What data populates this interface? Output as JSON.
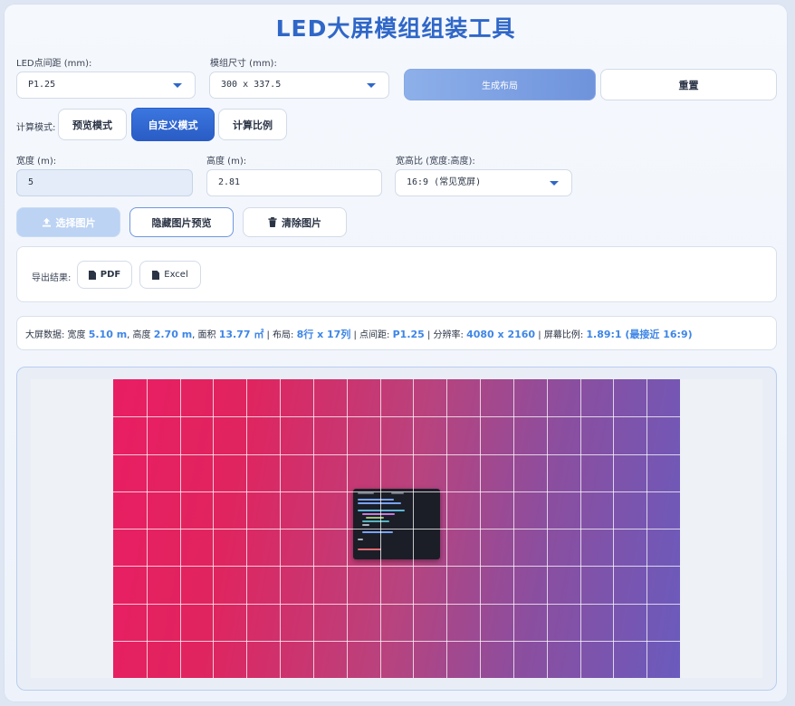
{
  "title": "LED大屏模组组装工具",
  "pitch": {
    "label": "LED点间距 (mm):",
    "value": "P1.25"
  },
  "module_size": {
    "label": "模组尺寸 (mm):",
    "value": "300 x 337.5"
  },
  "buttons": {
    "generate": "生成布局",
    "reset": "重置"
  },
  "mode": {
    "label": "计算模式:",
    "options": [
      "预览模式",
      "自定义模式",
      "计算比例"
    ],
    "active": "自定义模式"
  },
  "width": {
    "label": "宽度 (m):",
    "value": "5"
  },
  "height": {
    "label": "高度 (m):",
    "value": "2.81"
  },
  "ratio": {
    "label": "宽高比 (宽度:高度):",
    "value": "16:9 (常见宽屏)"
  },
  "image_actions": {
    "select": "选择图片",
    "hide_preview": "隐藏图片预览",
    "clear": "清除图片"
  },
  "export": {
    "label": "导出结果:",
    "pdf": "PDF",
    "excel": "Excel"
  },
  "stats": {
    "prefix": "大屏数据: 宽度 ",
    "width": "5.10 m",
    "t1": ", 高度 ",
    "height": "2.70 m",
    "t2": ", 面积 ",
    "area": "13.77 ㎡",
    "t3": " | 布局: ",
    "layout": "8行 x 17列",
    "t4": " | 点间距: ",
    "pitch": "P1.25",
    "t5": " | 分辨率: ",
    "resolution": "4080 x 2160",
    "t6": " | 屏幕比例: ",
    "ratio": "1.89:1 (最接近 16:9)"
  },
  "grid": {
    "rows": 8,
    "cols": 17
  },
  "colors": {
    "accent": "#2f67c8",
    "highlight": "#3f86e6",
    "gradient_start": "#e91e63",
    "gradient_end": "#6a5bbd"
  }
}
